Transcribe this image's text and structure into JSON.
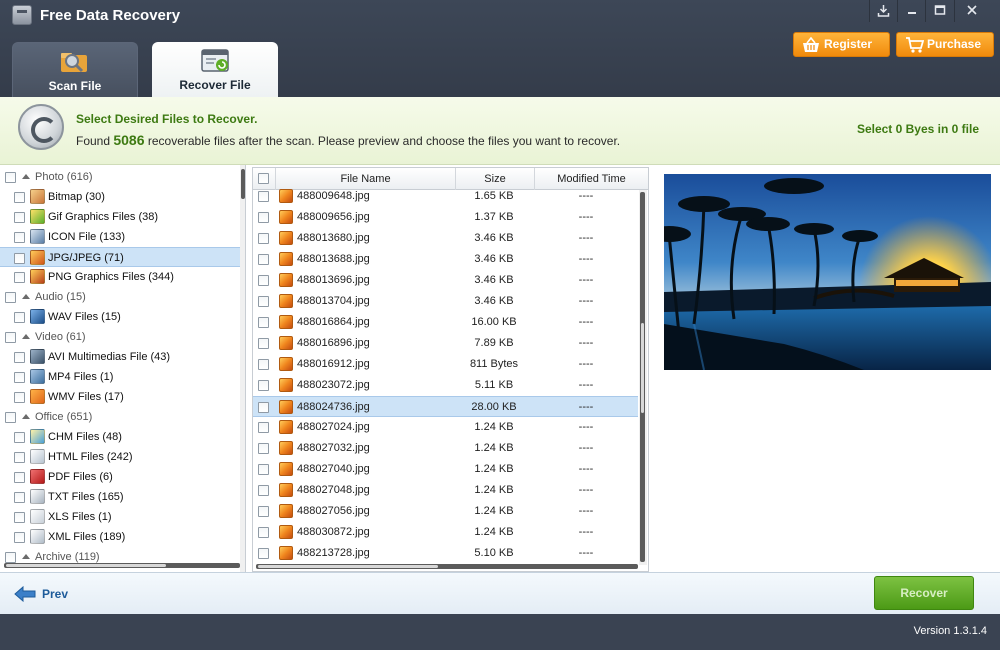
{
  "app": {
    "title": "Free Data Recovery",
    "window_buttons": [
      "download-icon",
      "minimize-icon",
      "maximize-icon",
      "close-icon"
    ]
  },
  "tabs": [
    {
      "label": "Scan File",
      "icon": "scan-folder-icon",
      "active": false
    },
    {
      "label": "Recover File",
      "icon": "recover-window-icon",
      "active": true
    }
  ],
  "header_buttons": {
    "register_label": "Register",
    "purchase_label": "Purchase"
  },
  "banner": {
    "title": "Select Desired Files to Recover.",
    "text_before": "Found ",
    "count": "5086",
    "text_after": " recoverable files after the scan. Please preview and choose the files you want to recover.",
    "selection_status": "Select 0 Byes in 0 file"
  },
  "tree": [
    {
      "label": "Photo (616)",
      "level": 0
    },
    {
      "label": "Bitmap (30)",
      "level": 1,
      "icon": "bitmap-icon"
    },
    {
      "label": "Gif Graphics Files (38)",
      "level": 1,
      "icon": "gif-icon"
    },
    {
      "label": "ICON File (133)",
      "level": 1,
      "icon": "ico-file-icon"
    },
    {
      "label": "JPG/JPEG (71)",
      "level": 1,
      "icon": "jpg-icon",
      "selected": true
    },
    {
      "label": "PNG Graphics Files (344)",
      "level": 1,
      "icon": "png-icon"
    },
    {
      "label": "Audio (15)",
      "level": 0
    },
    {
      "label": "WAV Files (15)",
      "level": 1,
      "icon": "wav-icon"
    },
    {
      "label": "Video (61)",
      "level": 0
    },
    {
      "label": "AVI Multimedias File (43)",
      "level": 1,
      "icon": "avi-icon"
    },
    {
      "label": "MP4 Files (1)",
      "level": 1,
      "icon": "mp4-icon"
    },
    {
      "label": "WMV Files (17)",
      "level": 1,
      "icon": "wmv-icon"
    },
    {
      "label": "Office (651)",
      "level": 0
    },
    {
      "label": "CHM Files (48)",
      "level": 1,
      "icon": "chm-icon"
    },
    {
      "label": "HTML Files (242)",
      "level": 1,
      "icon": "html-icon"
    },
    {
      "label": "PDF Files (6)",
      "level": 1,
      "icon": "pdf-icon"
    },
    {
      "label": "TXT Files (165)",
      "level": 1,
      "icon": "txt-icon"
    },
    {
      "label": "XLS Files (1)",
      "level": 1,
      "icon": "xls-icon"
    },
    {
      "label": "XML Files (189)",
      "level": 1,
      "icon": "xml-icon"
    },
    {
      "label": "Archive (119)",
      "level": 0
    }
  ],
  "file_list": {
    "columns": [
      "File Name",
      "Size",
      "Modified Time"
    ],
    "rows": [
      {
        "name": "488009648.jpg",
        "size": "1.65 KB",
        "time": "----"
      },
      {
        "name": "488009656.jpg",
        "size": "1.37 KB",
        "time": "----"
      },
      {
        "name": "488013680.jpg",
        "size": "3.46 KB",
        "time": "----"
      },
      {
        "name": "488013688.jpg",
        "size": "3.46 KB",
        "time": "----"
      },
      {
        "name": "488013696.jpg",
        "size": "3.46 KB",
        "time": "----"
      },
      {
        "name": "488013704.jpg",
        "size": "3.46 KB",
        "time": "----"
      },
      {
        "name": "488016864.jpg",
        "size": "16.00 KB",
        "time": "----"
      },
      {
        "name": "488016896.jpg",
        "size": "7.89 KB",
        "time": "----"
      },
      {
        "name": "488016912.jpg",
        "size": "811 Bytes",
        "time": "----"
      },
      {
        "name": "488023072.jpg",
        "size": "5.11 KB",
        "time": "----"
      },
      {
        "name": "488024736.jpg",
        "size": "28.00 KB",
        "time": "----",
        "selected": true
      },
      {
        "name": "488027024.jpg",
        "size": "1.24 KB",
        "time": "----"
      },
      {
        "name": "488027032.jpg",
        "size": "1.24 KB",
        "time": "----"
      },
      {
        "name": "488027040.jpg",
        "size": "1.24 KB",
        "time": "----"
      },
      {
        "name": "488027048.jpg",
        "size": "1.24 KB",
        "time": "----"
      },
      {
        "name": "488027056.jpg",
        "size": "1.24 KB",
        "time": "----"
      },
      {
        "name": "488030872.jpg",
        "size": "1.24 KB",
        "time": "----"
      },
      {
        "name": "488213728.jpg",
        "size": "5.10 KB",
        "time": "----"
      }
    ]
  },
  "preview": {
    "description_icon": "tropical-sunset-photo"
  },
  "footer": {
    "prev_label": "Prev",
    "recover_label": "Recover",
    "version": "Version 1.3.1.4"
  },
  "colors": {
    "header_bg": "#3a4352",
    "accent_green": "#3d7a12",
    "orange_button": "#f5a020",
    "selection_blue": "#cde3f7",
    "recover_green": "#5fae28"
  }
}
